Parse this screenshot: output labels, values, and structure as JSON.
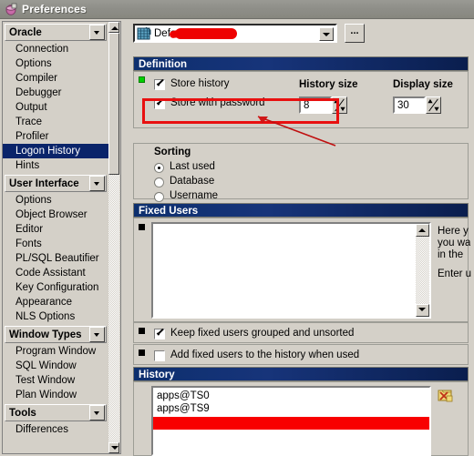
{
  "window": {
    "title": "Preferences",
    "icon": "preferences-icon"
  },
  "sidebar": {
    "groups": [
      {
        "header": "Oracle",
        "items": [
          {
            "label": "Connection",
            "selected": false
          },
          {
            "label": "Options",
            "selected": false
          },
          {
            "label": "Compiler",
            "selected": false
          },
          {
            "label": "Debugger",
            "selected": false
          },
          {
            "label": "Output",
            "selected": false
          },
          {
            "label": "Trace",
            "selected": false
          },
          {
            "label": "Profiler",
            "selected": false
          },
          {
            "label": "Logon History",
            "selected": true
          },
          {
            "label": "Hints",
            "selected": false
          }
        ]
      },
      {
        "header": "User Interface",
        "items": [
          {
            "label": "Options",
            "selected": false
          },
          {
            "label": "Object Browser",
            "selected": false
          },
          {
            "label": "Editor",
            "selected": false
          },
          {
            "label": "Fonts",
            "selected": false
          },
          {
            "label": "PL/SQL Beautifier",
            "selected": false
          },
          {
            "label": "Code Assistant",
            "selected": false
          },
          {
            "label": "Key Configuration",
            "selected": false
          },
          {
            "label": "Appearance",
            "selected": false
          },
          {
            "label": "NLS Options",
            "selected": false
          }
        ]
      },
      {
        "header": "Window Types",
        "items": [
          {
            "label": "Program Window",
            "selected": false
          },
          {
            "label": "SQL Window",
            "selected": false
          },
          {
            "label": "Test Window",
            "selected": false
          },
          {
            "label": "Plan Window",
            "selected": false
          }
        ]
      },
      {
        "header": "Tools",
        "items": [
          {
            "label": "Differences",
            "selected": false
          }
        ]
      }
    ]
  },
  "profile": {
    "value": "Default",
    "redacted": true,
    "ellipsis_label": "...",
    "icon": "profile-icon"
  },
  "definition": {
    "header": "Definition",
    "store_history": {
      "label": "Store history",
      "checked": true
    },
    "store_with_password": {
      "label": "Store with password",
      "checked": true
    },
    "history_size": {
      "label": "History size",
      "value": "8"
    },
    "display_size": {
      "label": "Display size",
      "value": "30"
    }
  },
  "sorting": {
    "label": "Sorting",
    "options": [
      {
        "label": "Last used",
        "selected": true
      },
      {
        "label": "Database",
        "selected": false
      },
      {
        "label": "Username",
        "selected": false
      }
    ]
  },
  "fixed_users": {
    "header": "Fixed Users",
    "memo_value": "",
    "help_lines": [
      "Here y",
      "you wa",
      "in the ",
      "Enter u"
    ],
    "keep_grouped": {
      "label": "Keep fixed users grouped and unsorted",
      "checked": true
    },
    "add_to_history": {
      "label": "Add fixed users to the history when used",
      "checked": false
    }
  },
  "history": {
    "header": "History",
    "items": [
      "apps@TS0",
      "apps@TS9"
    ],
    "redacted_row": true,
    "delete_icon": "delete-history-icon"
  },
  "annotation": {
    "highlight_color": "#e81010",
    "arrow_color": "#c01010"
  }
}
